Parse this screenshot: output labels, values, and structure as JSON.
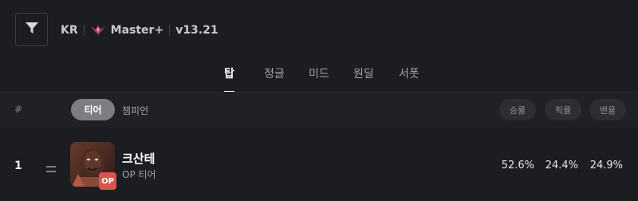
{
  "header": {
    "region": "KR",
    "tier_icon": "master-crest-icon",
    "tier": "Master+",
    "version": "v13.21"
  },
  "tabs": [
    {
      "label": "탑",
      "active": true
    },
    {
      "label": "정글",
      "active": false
    },
    {
      "label": "미드",
      "active": false
    },
    {
      "label": "원딜",
      "active": false
    },
    {
      "label": "서폿",
      "active": false
    }
  ],
  "table_header": {
    "rank": "#",
    "sort_tier": "티어",
    "sort_champion": "챔피언",
    "win_rate": "승률",
    "pick_rate": "픽률",
    "ban_rate": "밴율"
  },
  "rows": [
    {
      "rank": "1",
      "trend": "=",
      "badge": "OP",
      "champion": "크산테",
      "tier_label": "OP 티어",
      "win_rate": "52.6%",
      "pick_rate": "24.4%",
      "ban_rate": "24.9%"
    }
  ],
  "colors": {
    "background": "#1c1d21",
    "header_row": "#202126",
    "active_pill": "#7d7e84",
    "op_badge": "#d9534f",
    "tier_icon_accent": "#c94f8a"
  }
}
